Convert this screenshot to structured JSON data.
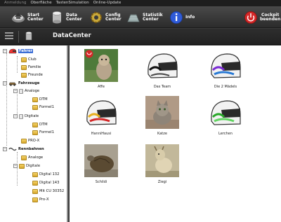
{
  "menu": [
    "Anmeldung",
    "Oberfläche",
    "TastenSimulation",
    "Online-Update"
  ],
  "toolbar": {
    "start": "Start\nCenter",
    "data": "Data\nCenter",
    "config": "Config\nCenter",
    "statistik": "Statistik\nCenter",
    "info": "Info",
    "cockpit": "Cockpit\nbeenden"
  },
  "subbar": {
    "title": "DataCenter"
  },
  "tree": {
    "fahrer": "Fahrer",
    "club": "Club",
    "familie": "Familie",
    "freunde": "Freunde",
    "fahrzeuge": "Fahrzeuge",
    "analoge": "Analoge",
    "dtm": "DTM",
    "formel1": "Formel1",
    "digitale": "Digitale",
    "prox": "PRO-X",
    "rennbahnen": "Rennbahnen",
    "digital132": "Digital 132",
    "digital143": "Digital 143",
    "mitcu": "Mit CU 30352",
    "prox2": "Pro-X"
  },
  "drivers": [
    "Affe",
    "Das Team",
    "Die 2 Mädels",
    "HanniHausi",
    "Katze",
    "Lerchen",
    "Schildi",
    "Ziegi"
  ],
  "colors": {
    "selection": "#3d6fd6",
    "toolbar": "#3a3a3a"
  }
}
